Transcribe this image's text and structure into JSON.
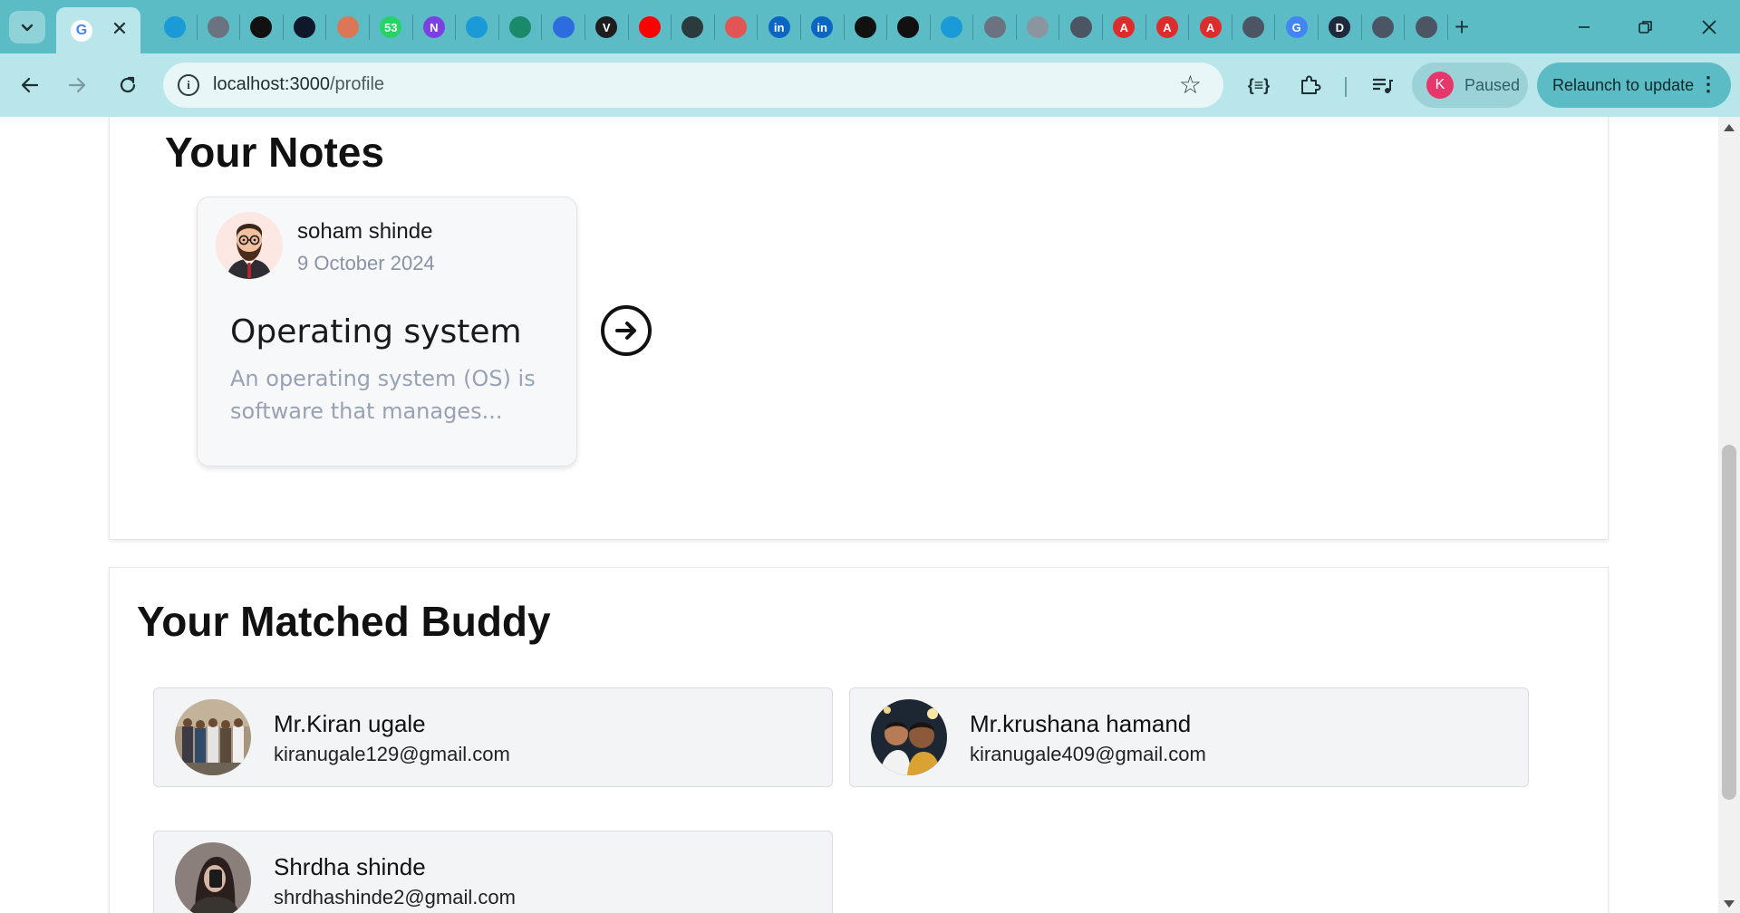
{
  "browser": {
    "url_host": "localhost:3000",
    "url_path": "/profile",
    "profile_initial": "K",
    "profile_status": "Paused",
    "relaunch_label": "Relaunch to update",
    "active_tab_favicon": "G",
    "tab_favicons": [
      {
        "icon": "chrome-web-store-icon",
        "color": "#1a9bd7",
        "glyph": ""
      },
      {
        "icon": "globe-icon",
        "color": "#6b7280",
        "glyph": ""
      },
      {
        "icon": "circle-slash-icon",
        "color": "#111111",
        "glyph": ""
      },
      {
        "icon": "bolt-icon",
        "color": "#0f172a",
        "glyph": ""
      },
      {
        "icon": "figure-icon",
        "color": "#d97757",
        "glyph": ""
      },
      {
        "icon": "whatsapp-icon",
        "color": "#25d366",
        "glyph": "53"
      },
      {
        "icon": "n-logo-icon",
        "color": "#7b3fe4",
        "glyph": "N"
      },
      {
        "icon": "play-circle-icon",
        "color": "#1a9bd7",
        "glyph": ""
      },
      {
        "icon": "m-logo-icon",
        "color": "#1a8a6b",
        "glyph": ""
      },
      {
        "icon": "bird-icon",
        "color": "#2d6cdf",
        "glyph": ""
      },
      {
        "icon": "vimeo-icon",
        "color": "#1e1e1e",
        "glyph": "V"
      },
      {
        "icon": "youtube-icon",
        "color": "#ff0000",
        "glyph": ""
      },
      {
        "icon": "astronaut-icon",
        "color": "#2b3b3d",
        "glyph": ""
      },
      {
        "icon": "cloud-icon",
        "color": "#e25555",
        "glyph": ""
      },
      {
        "icon": "linkedin-icon",
        "color": "#0a66c2",
        "glyph": "in"
      },
      {
        "icon": "linkedin-icon",
        "color": "#0a66c2",
        "glyph": "in"
      },
      {
        "icon": "chatgpt-icon",
        "color": "#111111",
        "glyph": ""
      },
      {
        "icon": "github-icon",
        "color": "#111111",
        "glyph": ""
      },
      {
        "icon": "chrome-web-store-icon",
        "color": "#1a9bd7",
        "glyph": ""
      },
      {
        "icon": "globe-icon",
        "color": "#6b7280",
        "glyph": ""
      },
      {
        "icon": "globe-icon",
        "color": "#8b95a0",
        "glyph": ""
      },
      {
        "icon": "chrome-icon",
        "color": "#4b5563",
        "glyph": ""
      },
      {
        "icon": "angular-icon",
        "color": "#dd2c2c",
        "glyph": "A"
      },
      {
        "icon": "angular-icon",
        "color": "#dd2c2c",
        "glyph": "A"
      },
      {
        "icon": "angular-icon",
        "color": "#dd2c2c",
        "glyph": "A"
      },
      {
        "icon": "chrome-icon",
        "color": "#4b5563",
        "glyph": ""
      },
      {
        "icon": "google-icon",
        "color": "#4285f4",
        "glyph": "G"
      },
      {
        "icon": "d-logo-icon",
        "color": "#1e293b",
        "glyph": "D"
      },
      {
        "icon": "chrome-icon",
        "color": "#4b5563",
        "glyph": ""
      },
      {
        "icon": "chrome-icon",
        "color": "#4b5563",
        "glyph": ""
      }
    ]
  },
  "notes_section": {
    "title": "Your Notes",
    "note": {
      "author": "soham shinde",
      "date": "9 October 2024",
      "title": "Operating system",
      "excerpt": "An operating system (OS) is software that manages..."
    }
  },
  "buddy_section": {
    "title": "Your Matched Buddy",
    "buddies": [
      {
        "name": "Mr.Kiran ugale",
        "email": "kiranugale129@gmail.com"
      },
      {
        "name": "Mr.krushana hamand",
        "email": "kiranugale409@gmail.com"
      },
      {
        "name": "Shrdha shinde",
        "email": "shrdhashinde2@gmail.com"
      }
    ]
  }
}
